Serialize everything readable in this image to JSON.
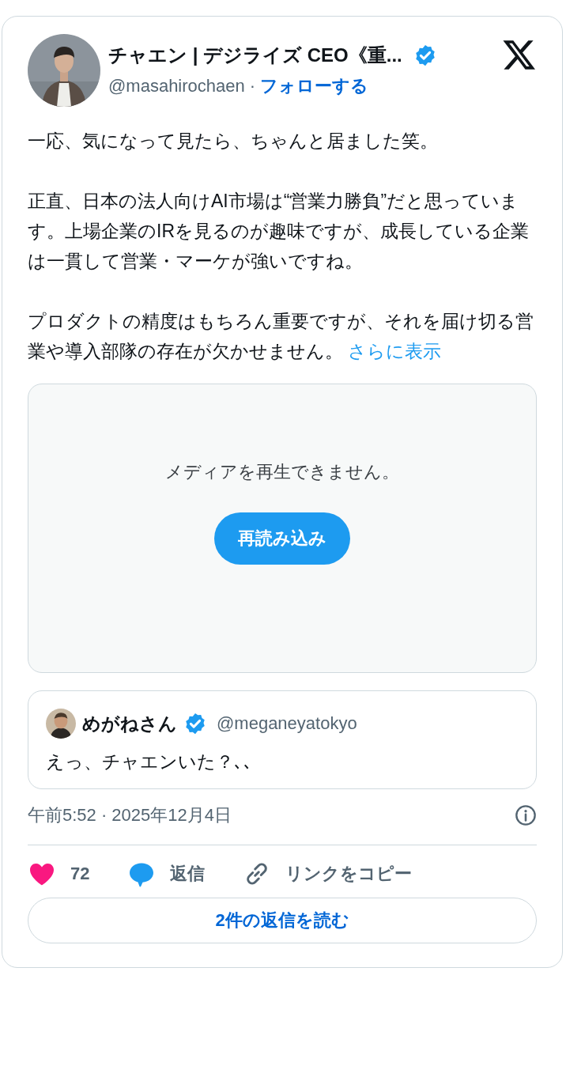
{
  "author": {
    "name": "チャエン | デジライズ CEO《重...",
    "handle": "@masahirochaen",
    "separator": "·",
    "follow": "フォローする",
    "verified": true
  },
  "body": {
    "paragraphs": [
      "一応、気になって見たら、ちゃんと居ました笑。",
      "正直、日本の法人向けAI市場は“営業力勝負”だと思っています。上場企業のIRを見るのが趣味ですが、成長している企業は一貫して営業・マーケが強いですね。",
      "プロダクトの精度はもちろん重要ですが、それを届け切る営業や導入部隊の存在が欠かせません。"
    ],
    "more": "さらに表示"
  },
  "media": {
    "message": "メディアを再生できません。",
    "reload": "再読み込み"
  },
  "quote": {
    "name": "めがねさん",
    "verified": true,
    "handle": "@meganeyatokyo",
    "text": "えっ、チャエンいた？､､"
  },
  "timestamp": "午前5:52 · 2025年12月4日",
  "actions": [
    {
      "kind": "like",
      "label": "72"
    },
    {
      "kind": "reply",
      "label": "返信"
    },
    {
      "kind": "link",
      "label": "リンクをコピー"
    }
  ],
  "read_replies": "2件の返信を読む"
}
